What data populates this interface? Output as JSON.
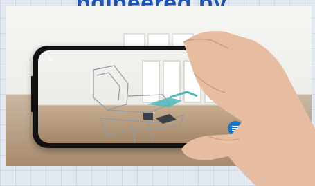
{
  "page": {
    "headline": "ngineered by"
  },
  "screen": {
    "icons": [
      "close-icon",
      "lock-icon",
      "cube-icon",
      "info-icon",
      "menu-icon"
    ]
  },
  "colors": {
    "headline": "#1e55b3",
    "fab": "#1877c9",
    "chair_accent": "#4fb6b8",
    "skin": "#e7bda2"
  }
}
